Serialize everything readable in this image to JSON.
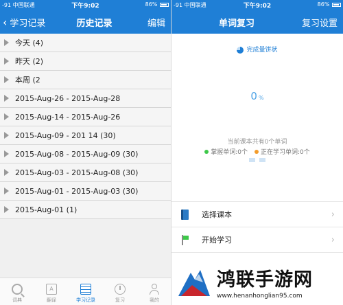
{
  "left": {
    "status": {
      "carrier": "-91 中国联通",
      "time": "下午9:02",
      "battery": "86%"
    },
    "nav": {
      "back_label": "学习记录",
      "title": "历史记录",
      "action": "编辑"
    },
    "history_rows": [
      "今天 (4)",
      "昨天 (2)",
      "本周 (2",
      "2015-Aug-26 - 2015-Aug-28",
      "2015-Aug-14 - 2015-Aug-26",
      "2015-Aug-09 - 201 14 (30)",
      "2015-Aug-08 - 2015-Aug-09 (30)",
      "2015-Aug-03 - 2015-Aug-08 (30)",
      "2015-Aug-01 - 2015-Aug-03 (30)",
      "2015-Aug-01 (1)"
    ],
    "tabs": [
      {
        "label": "词典",
        "icon": "search-icon"
      },
      {
        "label": "翻译",
        "icon": "translate-icon"
      },
      {
        "label": "学习记录",
        "icon": "notes-icon"
      },
      {
        "label": "复习",
        "icon": "clock-icon"
      },
      {
        "label": "我的",
        "icon": "person-icon"
      }
    ]
  },
  "right": {
    "status": {
      "carrier": "-91 中国联通",
      "time": "下午9:02",
      "battery": "86%"
    },
    "nav": {
      "title": "单词复习",
      "action": "复习设置"
    },
    "pie_label": "完成量饼状",
    "percent": {
      "value": "0",
      "sign": "%"
    },
    "total_text": "当前课本共有0个单词",
    "mastered_text": "掌握单词:0个",
    "learning_text": "正在学习单词:0个",
    "menu": [
      {
        "label": "选择课本",
        "icon": "book-icon"
      },
      {
        "label": "开始学习",
        "icon": "flag-icon"
      }
    ]
  },
  "watermark": {
    "title": "鸿联手游网",
    "url": "www.henanhonglian95.com"
  },
  "colors": {
    "accent": "#1f7fd6",
    "green": "#3ec84a",
    "orange": "#f39c2b"
  }
}
